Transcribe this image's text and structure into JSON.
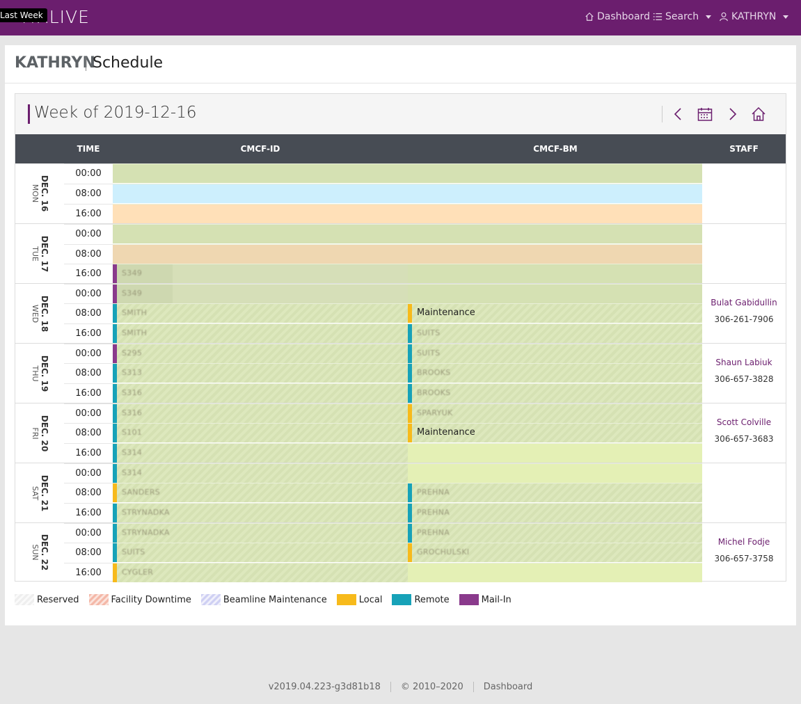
{
  "app": {
    "brand": "MXLIVE",
    "tooltip": "Last Week"
  },
  "nav": {
    "dashboard": "Dashboard",
    "search": "Search",
    "user": "KATHRYN"
  },
  "header": {
    "user": "KATHRYN",
    "title": "Schedule"
  },
  "schedule": {
    "week_title": "Week of 2019-12-16",
    "columns": {
      "time": "TIME",
      "beamline_1": "CMCF-ID",
      "beamline_2": "CMCF-BM",
      "staff": "STAFF"
    },
    "days": [
      {
        "date": "DEC. 16",
        "dow": "MON",
        "times": [
          "00:00",
          "08:00",
          "16:00"
        ]
      },
      {
        "date": "DEC. 17",
        "dow": "TUE",
        "times": [
          "00:00",
          "08:00",
          "16:00"
        ]
      },
      {
        "date": "DEC. 18",
        "dow": "WED",
        "times": [
          "00:00",
          "08:00",
          "16:00"
        ]
      },
      {
        "date": "DEC. 19",
        "dow": "THU",
        "times": [
          "00:00",
          "08:00",
          "16:00"
        ]
      },
      {
        "date": "DEC. 20",
        "dow": "FRI",
        "times": [
          "00:00",
          "08:00",
          "16:00"
        ]
      },
      {
        "date": "DEC. 21",
        "dow": "SAT",
        "times": [
          "00:00",
          "08:00",
          "16:00"
        ]
      },
      {
        "date": "DEC. 22",
        "dow": "SUN",
        "times": [
          "00:00",
          "08:00",
          "16:00"
        ]
      }
    ],
    "bookings": {
      "tue_16_id": "S349",
      "wed_00_id": "S349",
      "wed_08_id": "SMITH",
      "wed_08_bm": "Maintenance",
      "wed_16_id": "SMITH",
      "wed_16_bm": "SUITS",
      "thu_00_id": "S295",
      "thu_00_bm": "SUITS",
      "thu_08_id": "S313",
      "thu_08_bm": "BROOKS",
      "thu_16_id": "S316",
      "thu_16_bm": "BROOKS",
      "fri_00_id": "S316",
      "fri_00_bm": "SPARYUK",
      "fri_08_id": "S101",
      "fri_08_bm": "Maintenance",
      "fri_16_id": "S314",
      "sat_00_id": "S314",
      "sat_08_id": "SANDERS",
      "sat_08_bm": "PREHNA",
      "sat_16_id": "STRYNADKA",
      "sat_16_bm": "PREHNA",
      "sun_00_id": "STRYNADKA",
      "sun_00_bm": "PREHNA",
      "sun_08_id": "SUITS",
      "sun_08_bm": "GROCHULSKI",
      "sun_16_id": "CYGLER"
    },
    "staff": [
      {
        "name": "Bulat Gabidullin",
        "phone": "306-261-7906"
      },
      {
        "name": "Shaun Labiuk",
        "phone": "306-657-3828"
      },
      {
        "name": "Scott Colville",
        "phone": "306-657-3683"
      },
      {
        "name": "Michel Fodje",
        "phone": "306-657-3758"
      }
    ]
  },
  "legend": {
    "reserved": "Reserved",
    "downtime": "Facility Downtime",
    "maintenance": "Beamline Maintenance",
    "local": "Local",
    "remote": "Remote",
    "mailin": "Mail-In"
  },
  "colors": {
    "brand": "#6b1e6e",
    "local": "#f7ba1b",
    "remote": "#17a2b8",
    "mailin": "#8a3a8c",
    "header": "#474c54"
  },
  "footer": {
    "version": "v2019.04.223-g3d81b18",
    "copyright": "© 2010–2020",
    "link": "Dashboard"
  }
}
